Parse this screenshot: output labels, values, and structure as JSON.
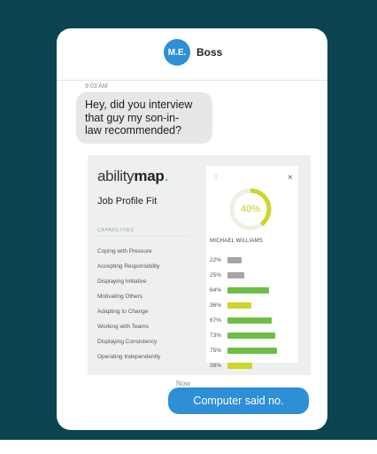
{
  "header": {
    "avatar_initials": "M.E.",
    "contact_name": "Boss"
  },
  "messages": {
    "incoming_time": "9:03 AM",
    "incoming_lines": [
      "Hey, did you interview",
      "that guy my son-in-",
      "law recommended?"
    ],
    "outgoing_time": "Now",
    "outgoing_text": "Computer said no."
  },
  "card": {
    "logo_light": "ability",
    "logo_bold": "map",
    "logo_dot": ".",
    "title": "Job Profile Fit",
    "capabilities_header": "CAPABILITIES",
    "panel": {
      "handle": "⠿",
      "close_label": "×",
      "overall_percent": 40,
      "overall_label": "40%",
      "person_name": "MICHAEL WILLIAMS"
    },
    "capabilities": [
      {
        "name": "Coping with Pressure",
        "percent": 22,
        "label": "22%",
        "color": "#a5a5a5"
      },
      {
        "name": "Accepting Responsibility",
        "percent": 25,
        "label": "25%",
        "color": "#a5a5a5"
      },
      {
        "name": "Displaying Initiative",
        "percent": 64,
        "label": "64%",
        "color": "#6cbe45"
      },
      {
        "name": "Motivating Others",
        "percent": 36,
        "label": "36%",
        "color": "#cdd52c"
      },
      {
        "name": "Adapting to Change",
        "percent": 67,
        "label": "67%",
        "color": "#6cbe45"
      },
      {
        "name": "Working with Teams",
        "percent": 73,
        "label": "73%",
        "color": "#6cbe45"
      },
      {
        "name": "Displaying Consistency",
        "percent": 75,
        "label": "75%",
        "color": "#6cbe45"
      },
      {
        "name": "Operating Independently",
        "percent": 38,
        "label": "38%",
        "color": "#cdd52c"
      }
    ]
  },
  "colors": {
    "background": "#0b4350",
    "accent_blue": "#2f8fd6",
    "ring_color": "#cdd52c",
    "green": "#6cbe45",
    "grey": "#a5a5a5"
  }
}
